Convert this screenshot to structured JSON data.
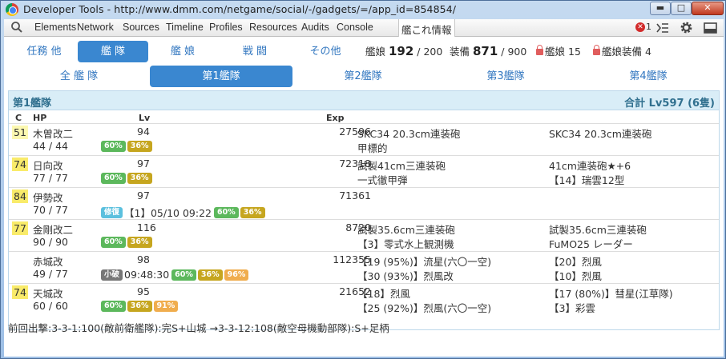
{
  "window": {
    "title": "Developer Tools - http://www.dmm.com/netgame/social/-/gadgets/=/app_id=854854/",
    "min": "▬",
    "max": "□",
    "close": "✕"
  },
  "devtools": {
    "tabs": [
      "Elements",
      "Network",
      "Sources",
      "Timeline",
      "Profiles",
      "Resources",
      "Audits",
      "Console",
      "艦これ情報"
    ],
    "error_count": "1"
  },
  "nav": {
    "items": [
      "任務 他",
      "艦 隊",
      "艦 娘",
      "戦 闘",
      "その他"
    ],
    "active_index": 1
  },
  "counts": {
    "ship_label": "艦娘",
    "ship_cur": "192",
    "ship_max": "/ 200",
    "equip_label": "装備",
    "equip_cur": "871",
    "equip_max": "/ 900",
    "locked_ship_label": "艦娘",
    "locked_ship": "15",
    "locked_equip_label": "艦娘装備",
    "locked_equip": "4"
  },
  "fleet_tabs": {
    "items": [
      "全 艦 隊",
      "第1艦隊",
      "第2艦隊",
      "第3艦隊",
      "第4艦隊"
    ],
    "active_index": 1
  },
  "fleet": {
    "name": "第1艦隊",
    "total": "合計 Lv597 (6隻)",
    "headers": {
      "c": "C",
      "hp": "HP",
      "lv": "Lv",
      "exp": "Exp"
    }
  },
  "ships": [
    {
      "cond": "51",
      "cond_color": "#fcf8b0",
      "name": "木曽改二",
      "hp": "44 / 44",
      "lv": "94",
      "exp": "27596",
      "eq1": [
        "SKC34 20.3cm連装砲",
        "甲標的"
      ],
      "eq2": [
        "SKC34 20.3cm連装砲",
        ""
      ],
      "pills": [
        {
          "t": "60%",
          "c": "g"
        },
        {
          "t": "36%",
          "c": "y"
        }
      ],
      "pre": ""
    },
    {
      "cond": "74",
      "cond_color": "#f9eb6a",
      "name": "日向改",
      "hp": "77 / 77",
      "lv": "97",
      "exp": "72318",
      "eq1": [
        "試製41cm三連装砲",
        "一式徹甲弾"
      ],
      "eq2": [
        "41cm連装砲★+6",
        "【14】瑞雲12型"
      ],
      "pills": [
        {
          "t": "60%",
          "c": "g"
        },
        {
          "t": "36%",
          "c": "y"
        }
      ],
      "pre": ""
    },
    {
      "cond": "84",
      "cond_color": "#f9eb6a",
      "name": "伊勢改",
      "hp": "70 / 77",
      "lv": "97",
      "exp": "71361",
      "eq1": [
        "",
        ""
      ],
      "eq2": [
        "",
        ""
      ],
      "pills": [
        {
          "t": "60%",
          "c": "g"
        },
        {
          "t": "36%",
          "c": "y"
        }
      ],
      "pre_badge": "修復",
      "pre": "【1】05/10 09:22"
    },
    {
      "cond": "77",
      "cond_color": "#f9eb6a",
      "name": "金剛改二",
      "hp": "90 / 90",
      "lv": "116",
      "exp": "8720",
      "eq1": [
        "試製35.6cm三連装砲",
        "【3】零式水上観測機"
      ],
      "eq2": [
        "試製35.6cm三連装砲",
        "FuMO25 レーダー"
      ],
      "pills": [
        {
          "t": "60%",
          "c": "g"
        },
        {
          "t": "36%",
          "c": "y"
        }
      ],
      "pre": ""
    },
    {
      "cond": "",
      "cond_color": "transparent",
      "name": "赤城改",
      "hp": "49 / 77",
      "lv": "98",
      "exp": "112355",
      "eq1": [
        "【19 (95%)】流星(六〇一空)",
        "【30 (93%)】烈風改"
      ],
      "eq2": [
        "【20】烈風",
        "【10】烈風"
      ],
      "pills": [
        {
          "t": "60%",
          "c": "g"
        },
        {
          "t": "36%",
          "c": "y"
        },
        {
          "t": "96%",
          "c": "o"
        }
      ],
      "pre_badge": "小破",
      "pre": "09:48:30"
    },
    {
      "cond": "74",
      "cond_color": "#f9eb6a",
      "name": "天城改",
      "hp": "60 / 60",
      "lv": "95",
      "exp": "21652",
      "eq1": [
        "【18】烈風",
        "【25 (92%)】烈風(六〇一空)"
      ],
      "eq2": [
        "【17 (80%)】彗星(江草隊)",
        "【3】彩雲"
      ],
      "pills": [
        {
          "t": "60%",
          "c": "g"
        },
        {
          "t": "36%",
          "c": "y"
        },
        {
          "t": "91%",
          "c": "o"
        }
      ],
      "pre": ""
    }
  ],
  "footer": "前回出撃:3-3-1:100(敵前衛艦隊):完S+山城 →3-3-12:108(敵空母機動部隊):S+足柄"
}
